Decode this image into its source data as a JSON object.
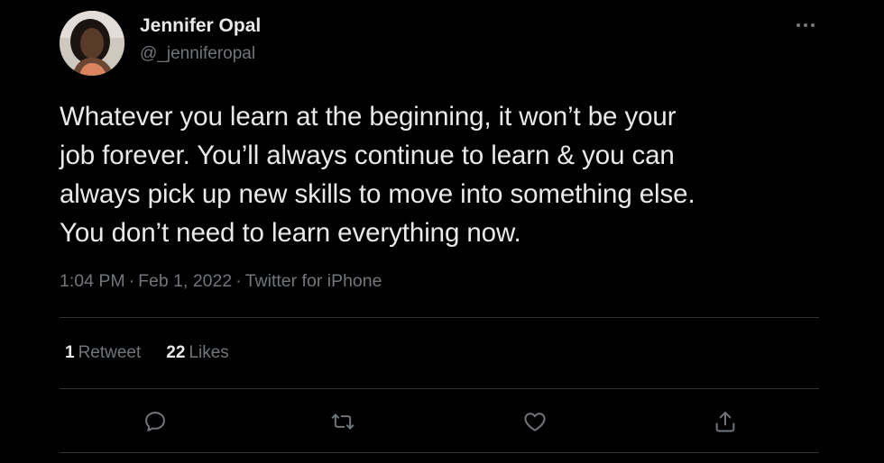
{
  "author": {
    "display_name": "Jennifer Opal",
    "handle": "@_jenniferopal",
    "avatar_icon": "profile-photo"
  },
  "more_icon": "ellipsis-horizontal-icon",
  "tweet": {
    "text": "Whatever you learn at the beginning, it won’t be your\njob forever. You’ll always continue to learn & you can\nalways pick up new skills to move into something else.\nYou don’t need to learn everything now."
  },
  "meta": {
    "time": "1:04 PM",
    "separator": "·",
    "date": "Feb 1, 2022",
    "source": "Twitter for iPhone"
  },
  "stats": {
    "retweets_count": "1",
    "retweets_label": "Retweet",
    "likes_count": "22",
    "likes_label": "Likes"
  },
  "actions": [
    {
      "name": "reply",
      "icon": "reply-icon"
    },
    {
      "name": "retweet",
      "icon": "retweet-icon"
    },
    {
      "name": "like",
      "icon": "heart-icon"
    },
    {
      "name": "share",
      "icon": "share-icon"
    }
  ],
  "colors": {
    "background": "#000000",
    "primary_text": "#e7e9ea",
    "secondary_text": "#71767b",
    "divider": "#2f3336"
  }
}
